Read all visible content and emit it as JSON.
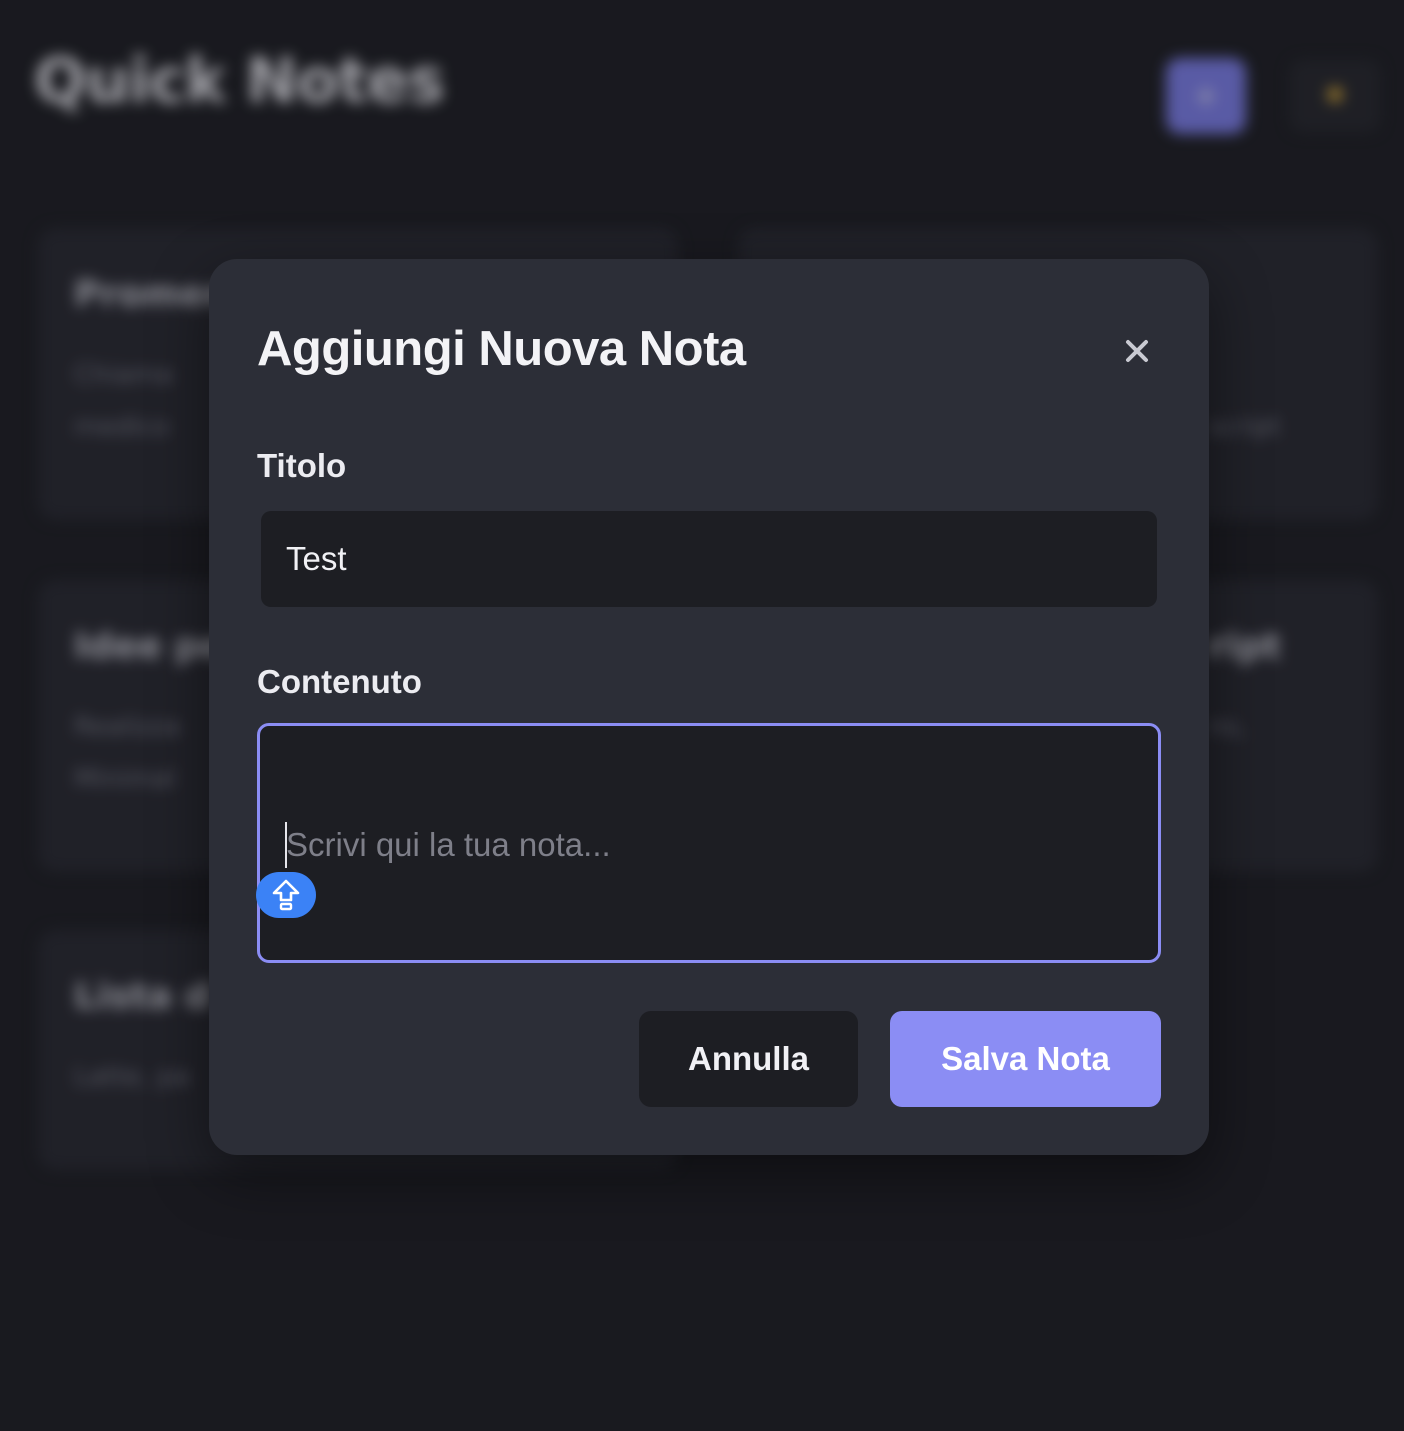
{
  "app": {
    "title": "Quick Notes",
    "add_button_icon": "plus-icon",
    "theme_button_icon": "sun-icon"
  },
  "background_cards": [
    {
      "title": "Promem",
      "lines": [
        "Chiama",
        "medico"
      ]
    },
    {
      "title": "",
      "lines": [
        "",
        "script"
      ]
    },
    {
      "title": "Idee pe",
      "lines": [
        "Realizza",
        "Minimal"
      ]
    },
    {
      "title": "ript",
      "lines": [
        "ns,"
      ]
    },
    {
      "title": "Lista d",
      "lines": [
        "Latte, pa"
      ]
    }
  ],
  "modal": {
    "title": "Aggiungi Nuova Nota",
    "close_icon": "close-icon",
    "title_label": "Titolo",
    "title_value": "Test",
    "content_label": "Contenuto",
    "content_placeholder": "Scrivi qui la tua nota...",
    "cancel_label": "Annulla",
    "save_label": "Salva Nota"
  },
  "colors": {
    "accent": "#8b8df4",
    "modal_bg": "#2c2e37",
    "input_bg": "#1d1e23",
    "page_bg": "#1c1d22",
    "shift_badge": "#3b82f6"
  }
}
